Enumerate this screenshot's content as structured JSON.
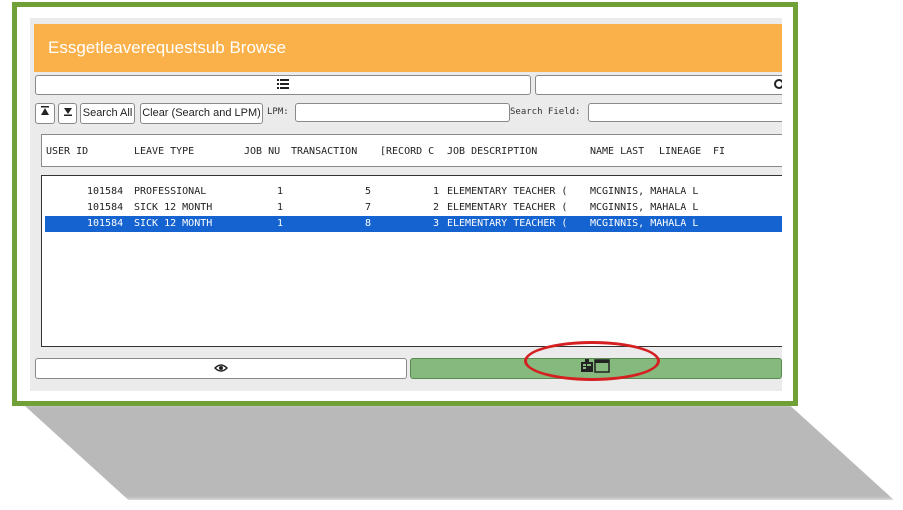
{
  "window": {
    "title": "Essgetleaverequestsub Browse"
  },
  "toolbar": {
    "search_all_label": "Search All",
    "clear_label": "Clear (Search and LPM)",
    "lpm_label": "LPM:",
    "lpm_value": "",
    "search_field_label": "Search Field:",
    "search_field_value": ""
  },
  "columns": [
    "USER ID",
    "LEAVE TYPE",
    "JOB NU",
    "TRANSACTION",
    "[RECORD C",
    "JOB DESCRIPTION",
    "NAME LAST",
    "LINEAGE",
    "FI"
  ],
  "rows": [
    {
      "user_id": "101584",
      "leave_type": "PROFESSIONAL",
      "job_nu": "1",
      "transaction": "5",
      "record": "1",
      "job_description": "ELEMENTARY TEACHER (",
      "name": "MCGINNIS, MAHALA L",
      "selected": false
    },
    {
      "user_id": "101584",
      "leave_type": "SICK 12 MONTH",
      "job_nu": "1",
      "transaction": "7",
      "record": "2",
      "job_description": "ELEMENTARY TEACHER (",
      "name": "MCGINNIS, MAHALA L",
      "selected": false
    },
    {
      "user_id": "101584",
      "leave_type": "SICK 12 MONTH",
      "job_nu": "1",
      "transaction": "8",
      "record": "3",
      "job_description": "ELEMENTARY TEACHER (",
      "name": "MCGINNIS, MAHALA L",
      "selected": true
    }
  ],
  "icons": {
    "menu": "list-icon",
    "search": "search-icon",
    "first": "arrow-up-bar-icon",
    "next": "arrow-down-icon",
    "view": "eye-icon",
    "detail": "detail-view-icon"
  },
  "colors": {
    "header": "#fbb149",
    "frame": "#70a038",
    "selection": "#1563d0",
    "detail_button": "#85b97e",
    "highlight": "#d42020"
  }
}
